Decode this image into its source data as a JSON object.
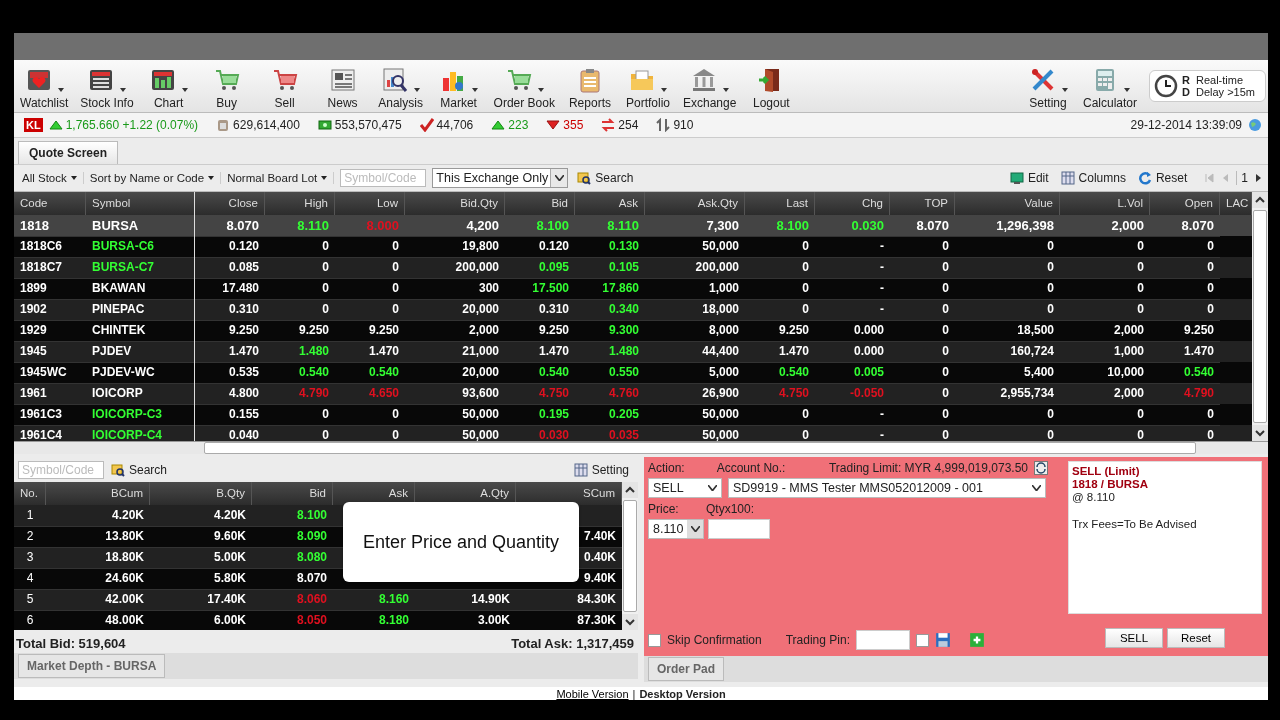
{
  "top_toolbar": {
    "items": [
      {
        "label": "Watchlist",
        "menu": true
      },
      {
        "label": "Stock Info",
        "menu": true
      },
      {
        "label": "Chart",
        "menu": true
      },
      {
        "label": "Buy",
        "menu": false
      },
      {
        "label": "Sell",
        "menu": false
      },
      {
        "label": "News",
        "menu": false
      },
      {
        "label": "Analysis",
        "menu": true
      },
      {
        "label": "Market",
        "menu": true
      },
      {
        "label": "Order Book",
        "menu": true
      },
      {
        "label": "Reports",
        "menu": false
      },
      {
        "label": "Portfolio",
        "menu": true
      },
      {
        "label": "Exchange",
        "menu": true
      },
      {
        "label": "Logout",
        "menu": false
      }
    ],
    "right_items": [
      {
        "label": "Setting",
        "menu": true
      },
      {
        "label": "Calculator",
        "menu": true
      }
    ],
    "feed": {
      "realtime_code": "R",
      "realtime": "Real-time",
      "delay_code": "D",
      "delay": "Delay >15m"
    }
  },
  "market_bar": {
    "exchange": "KL",
    "stats": [
      {
        "kind": "index",
        "text": "1,765.660 +1.22 (0.07%)"
      },
      {
        "kind": "volume",
        "text": "629,614,400"
      },
      {
        "kind": "value",
        "text": "553,570,475"
      },
      {
        "kind": "trades",
        "text": "44,706"
      },
      {
        "kind": "up",
        "text": "223"
      },
      {
        "kind": "down",
        "text": "355"
      },
      {
        "kind": "unchanged",
        "text": "254"
      },
      {
        "kind": "untraded",
        "text": "910"
      }
    ],
    "datetime": "29-12-2014 13:39:09"
  },
  "quote_tab": "Quote Screen",
  "filters": {
    "dropdowns": [
      "All Stock",
      "Sort by Name or Code",
      "Normal Board Lot"
    ],
    "symbol_placeholder": "Symbol/Code",
    "exchange_scope": "This Exchange Only",
    "search": "Search",
    "actions": [
      "Edit",
      "Columns",
      "Reset"
    ],
    "page": "1"
  },
  "quote": {
    "columns": [
      "Code",
      "Symbol",
      "Close",
      "High",
      "Low",
      "Bid.Qty",
      "Bid",
      "Ask",
      "Ask.Qty",
      "Last",
      "Chg",
      "TOP",
      "Value",
      "L.Vol",
      "Open",
      "LAC"
    ],
    "rows": [
      {
        "selected": true,
        "cells": [
          {
            "v": "1818"
          },
          {
            "v": "BURSA"
          },
          {
            "v": "8.070"
          },
          {
            "v": "8.110",
            "color": "#33ff33"
          },
          {
            "v": "8.000",
            "color": "#e0101f"
          },
          {
            "v": "4,200"
          },
          {
            "v": "8.100",
            "color": "#33ff33"
          },
          {
            "v": "8.110",
            "color": "#33ff33"
          },
          {
            "v": "7,300"
          },
          {
            "v": "8.100",
            "color": "#33ff33"
          },
          {
            "v": "0.030",
            "color": "#33ff33"
          },
          {
            "v": "8.070"
          },
          {
            "v": "1,296,398"
          },
          {
            "v": "2,000"
          },
          {
            "v": "8.070"
          }
        ]
      },
      {
        "selected": false,
        "cells": [
          {
            "v": "1818C6"
          },
          {
            "v": "BURSA-C6",
            "color": "#33ff33"
          },
          {
            "v": "0.120"
          },
          {
            "v": "0"
          },
          {
            "v": "0"
          },
          {
            "v": "19,800"
          },
          {
            "v": "0.120"
          },
          {
            "v": "0.130",
            "color": "#33ff33"
          },
          {
            "v": "50,000"
          },
          {
            "v": "0"
          },
          {
            "v": "-"
          },
          {
            "v": "0"
          },
          {
            "v": "0"
          },
          {
            "v": "0"
          },
          {
            "v": "0"
          }
        ]
      },
      {
        "selected": false,
        "cells": [
          {
            "v": "1818C7"
          },
          {
            "v": "BURSA-C7",
            "color": "#33ff33"
          },
          {
            "v": "0.085"
          },
          {
            "v": "0"
          },
          {
            "v": "0"
          },
          {
            "v": "200,000"
          },
          {
            "v": "0.095",
            "color": "#33ff33"
          },
          {
            "v": "0.105",
            "color": "#33ff33"
          },
          {
            "v": "200,000"
          },
          {
            "v": "0"
          },
          {
            "v": "-"
          },
          {
            "v": "0"
          },
          {
            "v": "0"
          },
          {
            "v": "0"
          },
          {
            "v": "0"
          }
        ]
      },
      {
        "selected": false,
        "cells": [
          {
            "v": "1899"
          },
          {
            "v": "BKAWAN"
          },
          {
            "v": "17.480"
          },
          {
            "v": "0"
          },
          {
            "v": "0"
          },
          {
            "v": "300"
          },
          {
            "v": "17.500",
            "color": "#33ff33"
          },
          {
            "v": "17.860",
            "color": "#33ff33"
          },
          {
            "v": "1,000"
          },
          {
            "v": "0"
          },
          {
            "v": "-"
          },
          {
            "v": "0"
          },
          {
            "v": "0"
          },
          {
            "v": "0"
          },
          {
            "v": "0"
          }
        ]
      },
      {
        "selected": false,
        "cells": [
          {
            "v": "1902"
          },
          {
            "v": "PINEPAC"
          },
          {
            "v": "0.310"
          },
          {
            "v": "0"
          },
          {
            "v": "0"
          },
          {
            "v": "20,000"
          },
          {
            "v": "0.310"
          },
          {
            "v": "0.340",
            "color": "#33ff33"
          },
          {
            "v": "18,000"
          },
          {
            "v": "0"
          },
          {
            "v": "-"
          },
          {
            "v": "0"
          },
          {
            "v": "0"
          },
          {
            "v": "0"
          },
          {
            "v": "0"
          }
        ]
      },
      {
        "selected": false,
        "cells": [
          {
            "v": "1929"
          },
          {
            "v": "CHINTEK"
          },
          {
            "v": "9.250"
          },
          {
            "v": "9.250"
          },
          {
            "v": "9.250"
          },
          {
            "v": "2,000"
          },
          {
            "v": "9.250"
          },
          {
            "v": "9.300",
            "color": "#33ff33"
          },
          {
            "v": "8,000"
          },
          {
            "v": "9.250"
          },
          {
            "v": "0.000"
          },
          {
            "v": "0"
          },
          {
            "v": "18,500"
          },
          {
            "v": "2,000"
          },
          {
            "v": "9.250"
          }
        ]
      },
      {
        "selected": false,
        "cells": [
          {
            "v": "1945"
          },
          {
            "v": "PJDEV"
          },
          {
            "v": "1.470"
          },
          {
            "v": "1.480",
            "color": "#33ff33"
          },
          {
            "v": "1.470"
          },
          {
            "v": "21,000"
          },
          {
            "v": "1.470"
          },
          {
            "v": "1.480",
            "color": "#33ff33"
          },
          {
            "v": "44,400"
          },
          {
            "v": "1.470"
          },
          {
            "v": "0.000"
          },
          {
            "v": "0"
          },
          {
            "v": "160,724"
          },
          {
            "v": "1,000"
          },
          {
            "v": "1.470"
          }
        ]
      },
      {
        "selected": false,
        "cells": [
          {
            "v": "1945WC"
          },
          {
            "v": "PJDEV-WC"
          },
          {
            "v": "0.535"
          },
          {
            "v": "0.540",
            "color": "#33ff33"
          },
          {
            "v": "0.540",
            "color": "#33ff33"
          },
          {
            "v": "20,000"
          },
          {
            "v": "0.540",
            "color": "#33ff33"
          },
          {
            "v": "0.550",
            "color": "#33ff33"
          },
          {
            "v": "5,000"
          },
          {
            "v": "0.540",
            "color": "#33ff33"
          },
          {
            "v": "0.005",
            "color": "#33ff33"
          },
          {
            "v": "0"
          },
          {
            "v": "5,400"
          },
          {
            "v": "10,000"
          },
          {
            "v": "0.540",
            "color": "#33ff33"
          }
        ]
      },
      {
        "selected": false,
        "cells": [
          {
            "v": "1961"
          },
          {
            "v": "IOICORP"
          },
          {
            "v": "4.800"
          },
          {
            "v": "4.790",
            "color": "#e0101f"
          },
          {
            "v": "4.650",
            "color": "#e0101f"
          },
          {
            "v": "93,600"
          },
          {
            "v": "4.750",
            "color": "#e0101f"
          },
          {
            "v": "4.760",
            "color": "#e0101f"
          },
          {
            "v": "26,900"
          },
          {
            "v": "4.750",
            "color": "#e0101f"
          },
          {
            "v": "-0.050",
            "color": "#e0101f"
          },
          {
            "v": "0"
          },
          {
            "v": "2,955,734"
          },
          {
            "v": "2,000"
          },
          {
            "v": "4.790",
            "color": "#e0101f"
          }
        ]
      },
      {
        "selected": false,
        "cells": [
          {
            "v": "1961C3"
          },
          {
            "v": "IOICORP-C3",
            "color": "#33ff33"
          },
          {
            "v": "0.155"
          },
          {
            "v": "0"
          },
          {
            "v": "0"
          },
          {
            "v": "50,000"
          },
          {
            "v": "0.195",
            "color": "#33ff33"
          },
          {
            "v": "0.205",
            "color": "#33ff33"
          },
          {
            "v": "50,000"
          },
          {
            "v": "0"
          },
          {
            "v": "-"
          },
          {
            "v": "0"
          },
          {
            "v": "0"
          },
          {
            "v": "0"
          },
          {
            "v": "0"
          }
        ]
      },
      {
        "selected": false,
        "cells": [
          {
            "v": "1961C4"
          },
          {
            "v": "IOICORP-C4",
            "color": "#33ff33"
          },
          {
            "v": "0.040"
          },
          {
            "v": "0"
          },
          {
            "v": "0"
          },
          {
            "v": "50,000"
          },
          {
            "v": "0.030",
            "color": "#e0101f"
          },
          {
            "v": "0.035",
            "color": "#e0101f"
          },
          {
            "v": "50,000"
          },
          {
            "v": "0"
          },
          {
            "v": "-"
          },
          {
            "v": "0"
          },
          {
            "v": "0"
          },
          {
            "v": "0"
          },
          {
            "v": "0"
          }
        ]
      }
    ]
  },
  "depth": {
    "symbol_placeholder": "Symbol/Code",
    "search": "Search",
    "setting": "Setting",
    "columns": [
      "No.",
      "BCum",
      "B.Qty",
      "Bid",
      "Ask",
      "A.Qty",
      "SCum"
    ],
    "rows": [
      {
        "cells": [
          {
            "v": "1"
          },
          {
            "v": "4.20K"
          },
          {
            "v": "4.20K"
          },
          {
            "v": "8.100",
            "color": "#33ff33"
          },
          null,
          null,
          null
        ]
      },
      {
        "cells": [
          {
            "v": "2"
          },
          {
            "v": "13.80K"
          },
          {
            "v": "9.60K"
          },
          {
            "v": "8.090",
            "color": "#33ff33"
          },
          null,
          null,
          {
            "v": "7.40K"
          }
        ]
      },
      {
        "cells": [
          {
            "v": "3"
          },
          {
            "v": "18.80K"
          },
          {
            "v": "5.00K"
          },
          {
            "v": "8.080",
            "color": "#33ff33"
          },
          null,
          null,
          {
            "v": "0.40K"
          }
        ]
      },
      {
        "cells": [
          {
            "v": "4"
          },
          {
            "v": "24.60K"
          },
          {
            "v": "5.80K"
          },
          {
            "v": "8.070"
          },
          null,
          null,
          {
            "v": "9.40K"
          }
        ]
      },
      {
        "cells": [
          {
            "v": "5"
          },
          {
            "v": "42.00K"
          },
          {
            "v": "17.40K"
          },
          {
            "v": "8.060",
            "color": "#e0101f"
          },
          {
            "v": "8.160",
            "color": "#33ff33"
          },
          {
            "v": "14.90K"
          },
          {
            "v": "84.30K"
          }
        ]
      },
      {
        "cells": [
          {
            "v": "6"
          },
          {
            "v": "48.00K"
          },
          {
            "v": "6.00K"
          },
          {
            "v": "8.050",
            "color": "#e0101f"
          },
          {
            "v": "8.180",
            "color": "#33ff33"
          },
          {
            "v": "3.00K"
          },
          {
            "v": "87.30K"
          }
        ]
      }
    ],
    "total_bid": "Total Bid: 519,604",
    "total_ask": "Total Ask: 1,317,459",
    "tab": "Market Depth - BURSA",
    "tooltip": "Enter Price and Quantity"
  },
  "order_pad": {
    "action_label": "Action:",
    "action": "SELL",
    "account_label": "Account No.:",
    "account": "SD9919 - MMS Tester MMS052012009 - 001",
    "trading_limit": "Trading Limit: MYR 4,999,019,073.50",
    "price_label": "Price:",
    "price": "8.110",
    "qty_label": "Qtyx100:",
    "summary": {
      "title": "SELL (Limit)",
      "stock": "1818 / BURSA",
      "price": "@ 8.110",
      "fees": "Trx Fees=To Be Advised"
    },
    "skip_confirmation": {
      "label": "Skip Confirmation",
      "checked": false
    },
    "pin_label": "Trading Pin:",
    "remember_pin": false,
    "buttons": [
      "SELL",
      "Reset"
    ],
    "tab": "Order Pad"
  },
  "footer": {
    "mobile": "Mobile Version",
    "separator": "|",
    "desktop": "Desktop Version"
  }
}
